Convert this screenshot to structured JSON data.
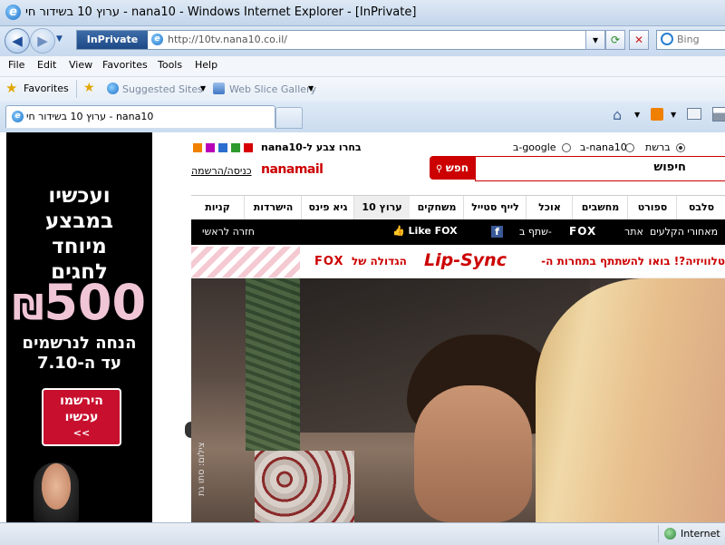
{
  "window": {
    "title": "ערוץ 10 בשידור חי - nana10 - Windows Internet Explorer - [InPrivate]"
  },
  "navigation": {
    "inprivate_label": "InPrivate",
    "url": "http://10tv.nana10.co.il/",
    "search_placeholder": "Bing"
  },
  "menu": {
    "items": [
      "File",
      "Edit",
      "View",
      "Favorites",
      "Tools",
      "Help"
    ]
  },
  "favorites_bar": {
    "favorites_label": "Favorites",
    "items": [
      "Suggested Sites",
      "Web Slice Gallery"
    ]
  },
  "tabs": [
    {
      "label": "ערוץ 10 בשידור חי - nana10"
    }
  ],
  "ad": {
    "lines": [
      "ועכשיו",
      "במבצע",
      "מיוחד",
      "לחגים",
      "500",
      "הנחה לנרשמים",
      "עד ה-7.10"
    ],
    "currency_symbol": "₪",
    "button_line1": "הירשמו",
    "button_line2": "עכשיו",
    "button_arrows": "<<"
  },
  "site": {
    "color_picker_label": "בחרו צבע ל-nana10",
    "swatch_colors": [
      "#d80000",
      "#2e9b2e",
      "#2a6fd0",
      "#b800b8",
      "#f0209e",
      "#f08000"
    ],
    "search_scope_options": [
      "ברשת",
      "ב-nana10",
      "ב-google"
    ],
    "search_input_value": "חיפוש",
    "search_button_label": "חפש",
    "nanamail_label": "nanamail",
    "login_label": "כניסה/הרשמה",
    "nav_tabs": [
      "סלבס",
      "ספורט",
      "מחשבים",
      "אוכל",
      "לייף סטייל",
      "משחקים",
      "ערוץ 10",
      "גיא פינס",
      "הישרדות",
      "קניות"
    ],
    "black_bar": {
      "backstage": "מאחורי הקלעים",
      "fox_site": "אתר",
      "fox_logo": "FOX",
      "share": "שתף ב-",
      "like": "Like",
      "like_fox": "FOX",
      "home": "חזרה לראשי"
    },
    "promo": {
      "text": "טלוויזיה?! בואו להשתתף בתחרות ה-",
      "brand": "Lip-Sync",
      "suffix": "הגדולה של",
      "fox": "FOX"
    },
    "photo_caption": "צילום: סתו גת"
  },
  "status_bar": {
    "zone": "Internet"
  }
}
